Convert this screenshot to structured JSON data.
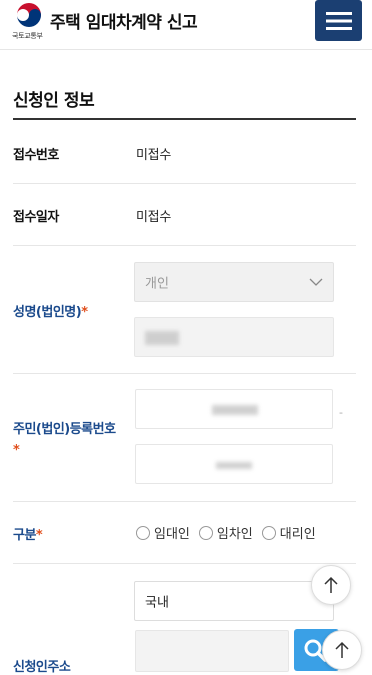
{
  "header": {
    "ministry_label": "국토교통부",
    "title": "주택 임대차계약 신고",
    "menu_icon": "hamburger-icon"
  },
  "section": {
    "title": "신청인 정보"
  },
  "receipt_number": {
    "label": "접수번호",
    "value": "미접수"
  },
  "receipt_date": {
    "label": "접수일자",
    "value": "미접수"
  },
  "name": {
    "label": "성명(법인명)",
    "required_mark": "*",
    "type_select": {
      "selected": "개인"
    }
  },
  "resident_number": {
    "label": "주민(법인)등록번호",
    "required_mark": "*",
    "separator": "-"
  },
  "category": {
    "label": "구분",
    "required_mark": "*",
    "options": [
      "임대인",
      "임차인",
      "대리인"
    ]
  },
  "address": {
    "label": "신청인주소",
    "region_select": {
      "selected": "국내"
    },
    "search_icon": "search-icon"
  },
  "floating": {
    "icon": "arrow-up-icon"
  },
  "colors": {
    "header_button": "#1b3f72",
    "label_blue": "#1b4a8c",
    "required": "#e04e1b",
    "search_button": "#3aa0e6"
  }
}
